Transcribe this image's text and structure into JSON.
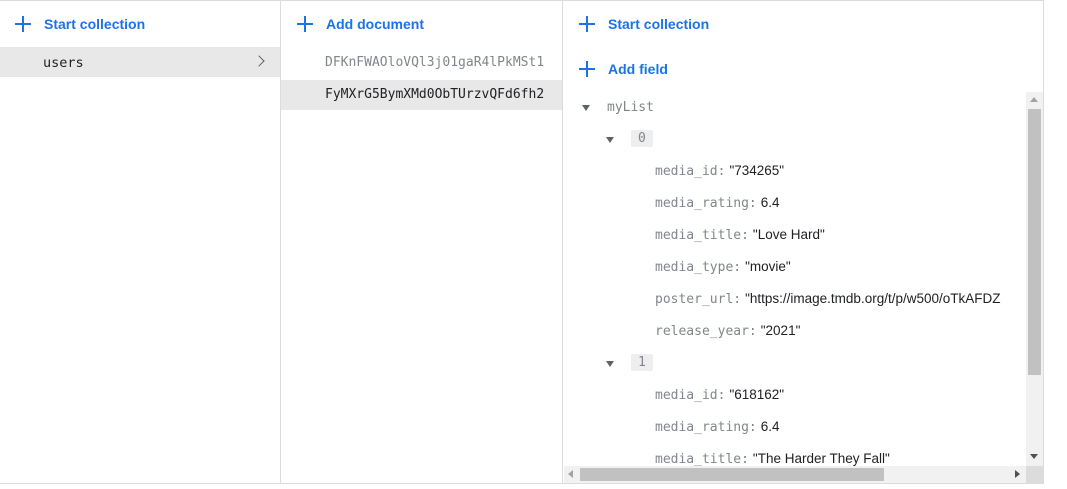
{
  "collections": {
    "start_label": "Start collection",
    "items": [
      {
        "label": "users"
      }
    ]
  },
  "documents": {
    "add_label": "Add document",
    "items": [
      {
        "id": "DFKnFWAOloVQl3j01gaR4lPkMSt1"
      },
      {
        "id": "FyMXrG5BymXMd0ObTUrzvQFd6fh2"
      }
    ]
  },
  "detail": {
    "start_label": "Start collection",
    "add_field_label": "Add field",
    "field_name": "myList",
    "entries": [
      {
        "index": "0",
        "fields": [
          {
            "key": "media_id:",
            "value": "\"734265\""
          },
          {
            "key": "media_rating:",
            "value": "6.4"
          },
          {
            "key": "media_title:",
            "value": "\"Love Hard\""
          },
          {
            "key": "media_type:",
            "value": "\"movie\""
          },
          {
            "key": "poster_url:",
            "value": "\"https://image.tmdb.org/t/p/w500/oTkAFDZ"
          },
          {
            "key": "release_year:",
            "value": "\"2021\""
          }
        ]
      },
      {
        "index": "1",
        "fields": [
          {
            "key": "media_id:",
            "value": "\"618162\""
          },
          {
            "key": "media_rating:",
            "value": "6.4"
          },
          {
            "key": "media_title:",
            "value": "\"The Harder They Fall\""
          }
        ]
      }
    ]
  },
  "colors": {
    "accent": "#1a73e8",
    "selected_row": "#e8e8e8",
    "border": "#dadce0"
  }
}
